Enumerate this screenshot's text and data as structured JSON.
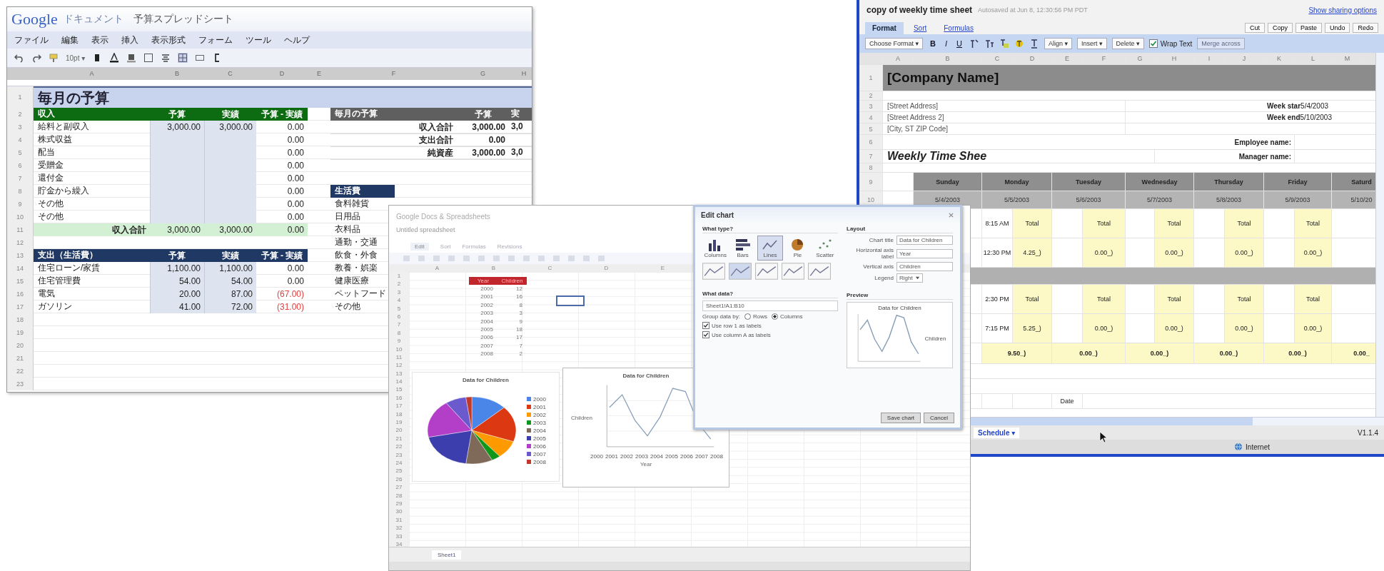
{
  "budget_window": {
    "logo": "Google",
    "product": "ドキュメント",
    "title": "予算スプレッドシート",
    "menu": [
      "ファイル",
      "編集",
      "表示",
      "挿入",
      "表示形式",
      "フォーム",
      "ツール",
      "ヘルプ"
    ],
    "font_size": "10pt ▾",
    "columns": [
      "A",
      "B",
      "C",
      "D",
      "E",
      "F",
      "G",
      "H"
    ],
    "first_row": "1",
    "sheet_title": "毎月の予算",
    "rows": [
      {
        "n": "2",
        "left": {
          "kind": "header",
          "color": "#0d6b12",
          "label": "収入",
          "budget": "予算",
          "actual": "実績",
          "diff": "予算 - 実績"
        },
        "right": {
          "kind": "header",
          "color": "#5f5f5f",
          "label": "毎月の予算",
          "budget": "予算",
          "actual": "実"
        }
      },
      {
        "n": "3",
        "left": {
          "kind": "item",
          "label": "給料と副収入",
          "budget": "3,000.00",
          "actual": "3,000.00",
          "diff": "0.00",
          "negative": false
        },
        "right": {
          "kind": "summary",
          "label": "収入合計",
          "budget": "3,000.00",
          "actual": "3,0"
        }
      },
      {
        "n": "4",
        "left": {
          "kind": "item",
          "label": "株式収益",
          "diff": "0.00",
          "negative": false
        },
        "right": {
          "kind": "summary",
          "label": "支出合計",
          "budget": "0.00"
        }
      },
      {
        "n": "5",
        "left": {
          "kind": "item",
          "label": "配当",
          "diff": "0.00",
          "negative": false
        },
        "right": {
          "kind": "summary",
          "label": "純資産",
          "budget": "3,000.00",
          "actual": "3,0"
        }
      },
      {
        "n": "6",
        "left": {
          "kind": "item",
          "label": "受贈金",
          "diff": "0.00",
          "negative": false
        }
      },
      {
        "n": "7",
        "left": {
          "kind": "item",
          "label": "還付金",
          "diff": "0.00",
          "negative": false
        }
      },
      {
        "n": "8",
        "left": {
          "kind": "item",
          "label": "貯金から繰入",
          "diff": "0.00",
          "negative": false
        },
        "right": {
          "kind": "section",
          "color": "#203864",
          "label": "生活費"
        }
      },
      {
        "n": "9",
        "left": {
          "kind": "item",
          "label": "その他",
          "diff": "0.00",
          "negative": false
        },
        "right": {
          "kind": "item",
          "label": "食料雑貨"
        }
      },
      {
        "n": "10",
        "left": {
          "kind": "item",
          "label": "その他",
          "diff": "0.00",
          "negative": false
        },
        "right": {
          "kind": "item",
          "label": "日用品"
        }
      },
      {
        "n": "11",
        "left": {
          "kind": "total",
          "label": "収入合計",
          "budget": "3,000.00",
          "actual": "3,000.00",
          "diff": "0.00"
        },
        "right": {
          "kind": "item",
          "label": "衣料品"
        }
      },
      {
        "n": "12",
        "right": {
          "kind": "item",
          "label": "通勤・交通"
        }
      },
      {
        "n": "13",
        "left": {
          "kind": "header",
          "color": "#203864",
          "label": "支出（生活費）",
          "budget": "予算",
          "actual": "実績",
          "diff": "予算 - 実績"
        },
        "right": {
          "kind": "item",
          "label": "飲食・外食"
        }
      },
      {
        "n": "14",
        "left": {
          "kind": "item",
          "label": "住宅ローン/家賃",
          "budget": "1,100.00",
          "actual": "1,100.00",
          "diff": "0.00",
          "negative": false
        },
        "right": {
          "kind": "item",
          "label": "教養・娯楽"
        }
      },
      {
        "n": "15",
        "left": {
          "kind": "item",
          "label": "住宅管理費",
          "budget": "54.00",
          "actual": "54.00",
          "diff": "0.00",
          "negative": false
        },
        "right": {
          "kind": "item",
          "label": "健康医療"
        }
      },
      {
        "n": "16",
        "left": {
          "kind": "item",
          "label": "電気",
          "budget": "20.00",
          "actual": "87.00",
          "diff": "(67.00)",
          "negative": true
        },
        "right": {
          "kind": "item",
          "label": "ペットフード"
        }
      },
      {
        "n": "17",
        "left": {
          "kind": "item",
          "label": "ガソリン",
          "budget": "41.00",
          "actual": "72.00",
          "diff": "(31.00)",
          "negative": true
        },
        "right": {
          "kind": "item",
          "label": "その他"
        }
      },
      {
        "n": "18"
      },
      {
        "n": "19"
      },
      {
        "n": "20"
      },
      {
        "n": "21"
      },
      {
        "n": "22"
      },
      {
        "n": "23"
      }
    ]
  },
  "chart_window": {
    "title": "Google Docs & Spreadsheets",
    "doc_name": "Untitled spreadsheet",
    "tabs": [
      {
        "label": "Edit",
        "selected": true
      },
      {
        "label": "Sort",
        "selected": false
      },
      {
        "label": "Formulas",
        "selected": false
      },
      {
        "label": "Revisions",
        "selected": false
      }
    ],
    "columns": [
      "A",
      "B",
      "C",
      "D",
      "E"
    ],
    "row_numbers": [
      "1",
      "2",
      "3",
      "4",
      "5",
      "6",
      "7",
      "8",
      "9",
      "10",
      "11",
      "12",
      "13",
      "14",
      "15",
      "16",
      "17",
      "18",
      "19",
      "20",
      "21",
      "22",
      "23",
      "24",
      "25",
      "26",
      "27",
      "28",
      "29",
      "30",
      "31",
      "32",
      "33",
      "34"
    ],
    "table": {
      "header": [
        "Year",
        "Children"
      ],
      "rows": [
        [
          "2000",
          "12"
        ],
        [
          "2001",
          "16"
        ],
        [
          "2002",
          "8"
        ],
        [
          "2003",
          "3"
        ],
        [
          "2004",
          "9"
        ],
        [
          "2005",
          "18"
        ],
        [
          "2006",
          "17"
        ],
        [
          "2007",
          "7"
        ],
        [
          "2008",
          "2"
        ]
      ]
    },
    "legend": [
      {
        "label": "2000",
        "color": "#4a86e8"
      },
      {
        "label": "2001",
        "color": "#dc3912"
      },
      {
        "label": "2002",
        "color": "#ff9900"
      },
      {
        "label": "2003",
        "color": "#109618"
      },
      {
        "label": "2004",
        "color": "#7f6a5a"
      },
      {
        "label": "2005",
        "color": "#3b3eac"
      },
      {
        "label": "2006",
        "color": "#b33fc8"
      },
      {
        "label": "2007",
        "color": "#6a5acd"
      },
      {
        "label": "2008",
        "color": "#c0392b"
      }
    ],
    "pie_title": "Data for Children",
    "line_title": "Data for Children",
    "line_xticks": [
      "2000",
      "2001",
      "2002",
      "2003",
      "2004",
      "2005",
      "2006",
      "2007",
      "2008"
    ],
    "line_xlabel": "Year",
    "line_ylabel": "Children",
    "sheet_tab": "Sheet1"
  },
  "chart_dialog": {
    "title": "Edit chart",
    "type_heading": "What type?",
    "types": [
      {
        "kind": "column",
        "label": "Columns",
        "selected": false
      },
      {
        "kind": "bar",
        "label": "Bars",
        "selected": false
      },
      {
        "kind": "line",
        "label": "Lines",
        "selected": true
      },
      {
        "kind": "pie",
        "label": "Pie",
        "selected": false
      },
      {
        "kind": "scatter",
        "label": "Scatter",
        "selected": false
      }
    ],
    "subtypes": [
      {
        "selected": false
      },
      {
        "selected": true
      },
      {
        "selected": false
      },
      {
        "selected": false
      },
      {
        "selected": false
      }
    ],
    "layout_heading": "Layout",
    "fields": [
      {
        "kind": "text",
        "label": "Chart title",
        "value": "Data for Children"
      },
      {
        "kind": "text",
        "label": "Horizontal axis label",
        "value": "Year"
      },
      {
        "kind": "text",
        "label": "Vertical axis",
        "value": "Children"
      },
      {
        "kind": "select",
        "label": "Legend",
        "value": "Right"
      }
    ],
    "data_heading": "What data?",
    "range": "Sheet1!A1:B10",
    "group_label": "Group data by:",
    "group_options": [
      {
        "label": "Rows",
        "selected": false
      },
      {
        "label": "Columns",
        "selected": true
      }
    ],
    "options": [
      {
        "label": "Use row 1 as labels",
        "checked": true
      },
      {
        "label": "Use column A as labels",
        "checked": true
      }
    ],
    "preview_heading": "Preview",
    "preview_title": "Data for Children",
    "preview_legend": "Children",
    "buttons": [
      "Save chart",
      "Cancel"
    ]
  },
  "timesheet_window": {
    "title": "copy of weekly time sheet",
    "autosave": "Autosaved at Jun 8, 12:30:56 PM PDT",
    "sharing_link": "Show sharing options",
    "tabs": [
      {
        "label": "Format",
        "selected": true
      },
      {
        "label": "Sort",
        "selected": false
      },
      {
        "label": "Formulas",
        "selected": false
      }
    ],
    "edit_buttons": [
      "Cut",
      "Copy",
      "Paste",
      "Undo",
      "Redo"
    ],
    "format_menu": "Choose Format ▾",
    "style_buttons": [
      "B",
      "I",
      "U"
    ],
    "menus": [
      "Align ▾",
      "Insert ▾",
      "Delete ▾"
    ],
    "wrap": {
      "label": "Wrap Text",
      "checked": true
    },
    "merge": {
      "label": "Merge across",
      "disabled": true
    },
    "columns": [
      "A",
      "B",
      "C",
      "D",
      "E",
      "F",
      "G",
      "H",
      "I",
      "J",
      "K",
      "L",
      "M"
    ],
    "row_numbers": [
      "1",
      "2",
      "3",
      "4",
      "5",
      "6",
      "7",
      "8",
      "9",
      "10"
    ],
    "company": "[Company Name]",
    "address": [
      "[Street Address]",
      "[Street Address 2]",
      "[City, ST ZIP Code]"
    ],
    "week": [
      {
        "label": "Week star",
        "value": "5/4/2003"
      },
      {
        "label": "Week end",
        "value": "5/10/2003"
      }
    ],
    "employee_label": "Employee name:",
    "manager_label": "Manager name:",
    "sheet_heading": "Weekly Time Shee",
    "days": [
      {
        "name": "Sunday",
        "date": "5/4/2003"
      },
      {
        "name": "Monday",
        "date": "5/5/2003"
      },
      {
        "name": "Tuesday",
        "date": "5/6/2003"
      },
      {
        "name": "Wednesday",
        "date": "5/7/2003"
      },
      {
        "name": "Thursday",
        "date": "5/8/2003"
      },
      {
        "name": "Friday",
        "date": "5/9/2003"
      },
      {
        "name": "Saturd",
        "date": "5/10/20"
      }
    ],
    "entries": [
      {
        "kind": "shift",
        "days": [
          {
            "time": "8:15 AM",
            "total": "Total"
          },
          {
            "total": "Total"
          },
          {
            "total": "Total"
          },
          {
            "total": "Total"
          },
          {
            "total": "Total"
          }
        ]
      },
      {
        "kind": "shift",
        "days": [
          {
            "time": "12:30 PM",
            "total": "4.25_)"
          },
          {
            "total": "0.00_)"
          },
          {
            "total": "0.00_)"
          },
          {
            "total": "0.00_)"
          },
          {
            "total": "0.00_)"
          }
        ]
      },
      {
        "kind": "break"
      },
      {
        "kind": "shift",
        "days": [
          {
            "time": "2:30 PM",
            "total": "Total"
          },
          {
            "total": "Total"
          },
          {
            "total": "Total"
          },
          {
            "total": "Total"
          },
          {
            "total": "Total"
          }
        ]
      },
      {
        "kind": "shift",
        "days": [
          {
            "time": "7:15 PM",
            "total": "5.25_)"
          },
          {
            "total": "0.00_)"
          },
          {
            "total": "0.00_)"
          },
          {
            "total": "0.00_)"
          },
          {
            "total": "0.00_)"
          }
        ]
      },
      {
        "kind": "sum",
        "values": [
          "9.50_)",
          "0.00_)",
          "0.00_)",
          "0.00_)",
          "0.00_)",
          "0.00_"
        ]
      }
    ],
    "date_label": "Date",
    "sheet_tab": "Schedule ▾",
    "version": "V1.1.4",
    "zone": "Internet"
  }
}
